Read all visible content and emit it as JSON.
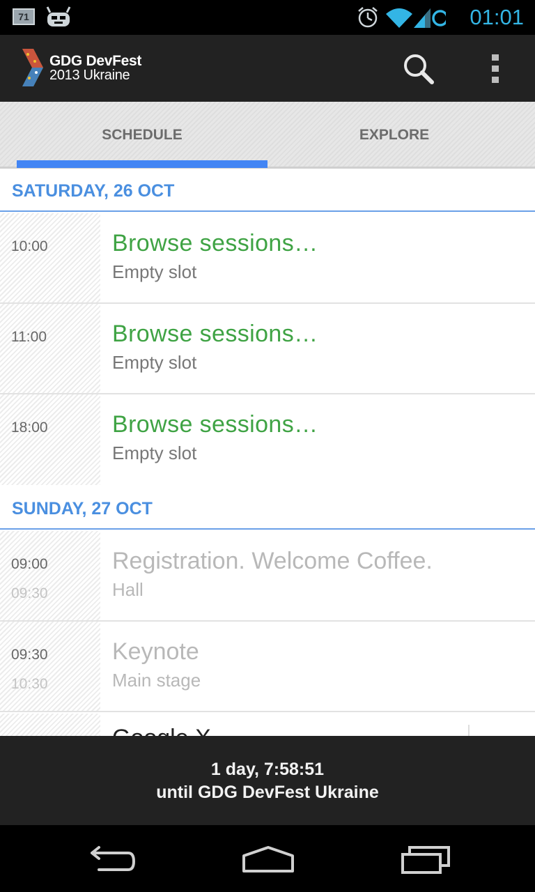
{
  "status_bar": {
    "notification_badge": "71",
    "time": "01:01",
    "icons": [
      "battery-notification-icon",
      "android-icon",
      "alarm-icon",
      "wifi-icon",
      "cell-signal-icon",
      "sync-icon"
    ]
  },
  "action_bar": {
    "logo_line1": "GDG DevFest",
    "logo_line2": "2013 Ukraine",
    "icons": [
      "search-icon",
      "overflow-menu-icon"
    ]
  },
  "tabs": [
    {
      "label": "SCHEDULE",
      "selected": true
    },
    {
      "label": "EXPLORE",
      "selected": false
    }
  ],
  "days": [
    {
      "header": "SATURDAY, 26 OCT",
      "rows": [
        {
          "start": "10:00",
          "end": "",
          "title": "Browse  sessions…",
          "subtitle": "Empty slot"
        },
        {
          "start": "11:00",
          "end": "",
          "title": "Browse  sessions…",
          "subtitle": "Empty slot"
        },
        {
          "start": "18:00",
          "end": "",
          "title": "Browse  sessions…",
          "subtitle": "Empty slot"
        }
      ]
    },
    {
      "header": "SUNDAY, 27 OCT",
      "rows": [
        {
          "start": "09:00",
          "end": "09:30",
          "title": "Registration. Welcome Coffee.",
          "subtitle": "Hall"
        },
        {
          "start": "09:30",
          "end": "10:30",
          "title": "Keynote",
          "subtitle": "Main stage"
        }
      ]
    }
  ],
  "partial_row": {
    "title": "Google X"
  },
  "countdown": {
    "line1": "1 day, 7:58:51",
    "line2": "until GDG DevFest Ukraine"
  },
  "nav_bar": {
    "icons": [
      "back-icon",
      "home-icon",
      "recent-apps-icon"
    ]
  },
  "colors": {
    "accent": "#4285f4",
    "day_header": "#4a8fe0",
    "browse_green": "#3fa344",
    "status_time": "#33b5e5"
  }
}
